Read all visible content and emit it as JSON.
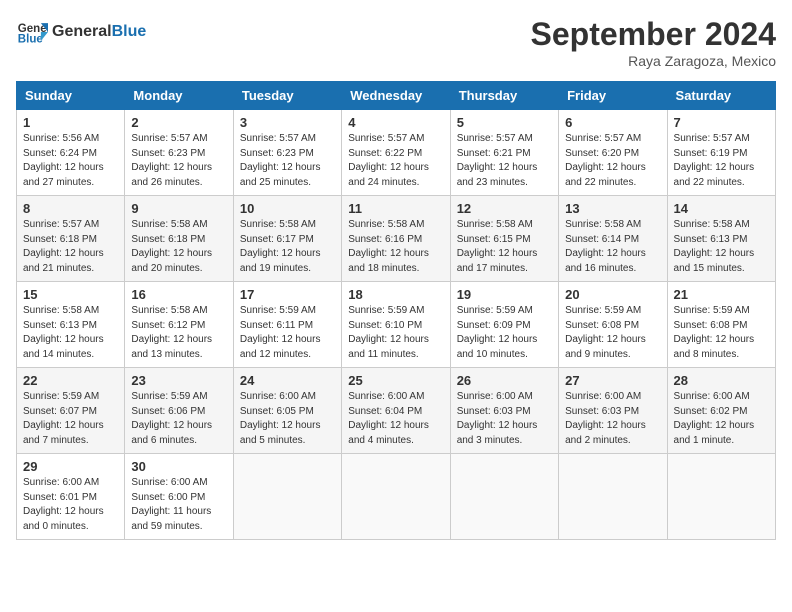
{
  "header": {
    "logo_line1": "General",
    "logo_line2": "Blue",
    "month": "September 2024",
    "location": "Raya Zaragoza, Mexico"
  },
  "weekdays": [
    "Sunday",
    "Monday",
    "Tuesday",
    "Wednesday",
    "Thursday",
    "Friday",
    "Saturday"
  ],
  "weeks": [
    [
      {
        "day": "1",
        "info": "Sunrise: 5:56 AM\nSunset: 6:24 PM\nDaylight: 12 hours\nand 27 minutes."
      },
      {
        "day": "2",
        "info": "Sunrise: 5:57 AM\nSunset: 6:23 PM\nDaylight: 12 hours\nand 26 minutes."
      },
      {
        "day": "3",
        "info": "Sunrise: 5:57 AM\nSunset: 6:23 PM\nDaylight: 12 hours\nand 25 minutes."
      },
      {
        "day": "4",
        "info": "Sunrise: 5:57 AM\nSunset: 6:22 PM\nDaylight: 12 hours\nand 24 minutes."
      },
      {
        "day": "5",
        "info": "Sunrise: 5:57 AM\nSunset: 6:21 PM\nDaylight: 12 hours\nand 23 minutes."
      },
      {
        "day": "6",
        "info": "Sunrise: 5:57 AM\nSunset: 6:20 PM\nDaylight: 12 hours\nand 22 minutes."
      },
      {
        "day": "7",
        "info": "Sunrise: 5:57 AM\nSunset: 6:19 PM\nDaylight: 12 hours\nand 22 minutes."
      }
    ],
    [
      {
        "day": "8",
        "info": "Sunrise: 5:57 AM\nSunset: 6:18 PM\nDaylight: 12 hours\nand 21 minutes."
      },
      {
        "day": "9",
        "info": "Sunrise: 5:58 AM\nSunset: 6:18 PM\nDaylight: 12 hours\nand 20 minutes."
      },
      {
        "day": "10",
        "info": "Sunrise: 5:58 AM\nSunset: 6:17 PM\nDaylight: 12 hours\nand 19 minutes."
      },
      {
        "day": "11",
        "info": "Sunrise: 5:58 AM\nSunset: 6:16 PM\nDaylight: 12 hours\nand 18 minutes."
      },
      {
        "day": "12",
        "info": "Sunrise: 5:58 AM\nSunset: 6:15 PM\nDaylight: 12 hours\nand 17 minutes."
      },
      {
        "day": "13",
        "info": "Sunrise: 5:58 AM\nSunset: 6:14 PM\nDaylight: 12 hours\nand 16 minutes."
      },
      {
        "day": "14",
        "info": "Sunrise: 5:58 AM\nSunset: 6:13 PM\nDaylight: 12 hours\nand 15 minutes."
      }
    ],
    [
      {
        "day": "15",
        "info": "Sunrise: 5:58 AM\nSunset: 6:13 PM\nDaylight: 12 hours\nand 14 minutes."
      },
      {
        "day": "16",
        "info": "Sunrise: 5:58 AM\nSunset: 6:12 PM\nDaylight: 12 hours\nand 13 minutes."
      },
      {
        "day": "17",
        "info": "Sunrise: 5:59 AM\nSunset: 6:11 PM\nDaylight: 12 hours\nand 12 minutes."
      },
      {
        "day": "18",
        "info": "Sunrise: 5:59 AM\nSunset: 6:10 PM\nDaylight: 12 hours\nand 11 minutes."
      },
      {
        "day": "19",
        "info": "Sunrise: 5:59 AM\nSunset: 6:09 PM\nDaylight: 12 hours\nand 10 minutes."
      },
      {
        "day": "20",
        "info": "Sunrise: 5:59 AM\nSunset: 6:08 PM\nDaylight: 12 hours\nand 9 minutes."
      },
      {
        "day": "21",
        "info": "Sunrise: 5:59 AM\nSunset: 6:08 PM\nDaylight: 12 hours\nand 8 minutes."
      }
    ],
    [
      {
        "day": "22",
        "info": "Sunrise: 5:59 AM\nSunset: 6:07 PM\nDaylight: 12 hours\nand 7 minutes."
      },
      {
        "day": "23",
        "info": "Sunrise: 5:59 AM\nSunset: 6:06 PM\nDaylight: 12 hours\nand 6 minutes."
      },
      {
        "day": "24",
        "info": "Sunrise: 6:00 AM\nSunset: 6:05 PM\nDaylight: 12 hours\nand 5 minutes."
      },
      {
        "day": "25",
        "info": "Sunrise: 6:00 AM\nSunset: 6:04 PM\nDaylight: 12 hours\nand 4 minutes."
      },
      {
        "day": "26",
        "info": "Sunrise: 6:00 AM\nSunset: 6:03 PM\nDaylight: 12 hours\nand 3 minutes."
      },
      {
        "day": "27",
        "info": "Sunrise: 6:00 AM\nSunset: 6:03 PM\nDaylight: 12 hours\nand 2 minutes."
      },
      {
        "day": "28",
        "info": "Sunrise: 6:00 AM\nSunset: 6:02 PM\nDaylight: 12 hours\nand 1 minute."
      }
    ],
    [
      {
        "day": "29",
        "info": "Sunrise: 6:00 AM\nSunset: 6:01 PM\nDaylight: 12 hours\nand 0 minutes."
      },
      {
        "day": "30",
        "info": "Sunrise: 6:00 AM\nSunset: 6:00 PM\nDaylight: 11 hours\nand 59 minutes."
      },
      {
        "day": "",
        "info": ""
      },
      {
        "day": "",
        "info": ""
      },
      {
        "day": "",
        "info": ""
      },
      {
        "day": "",
        "info": ""
      },
      {
        "day": "",
        "info": ""
      }
    ]
  ]
}
